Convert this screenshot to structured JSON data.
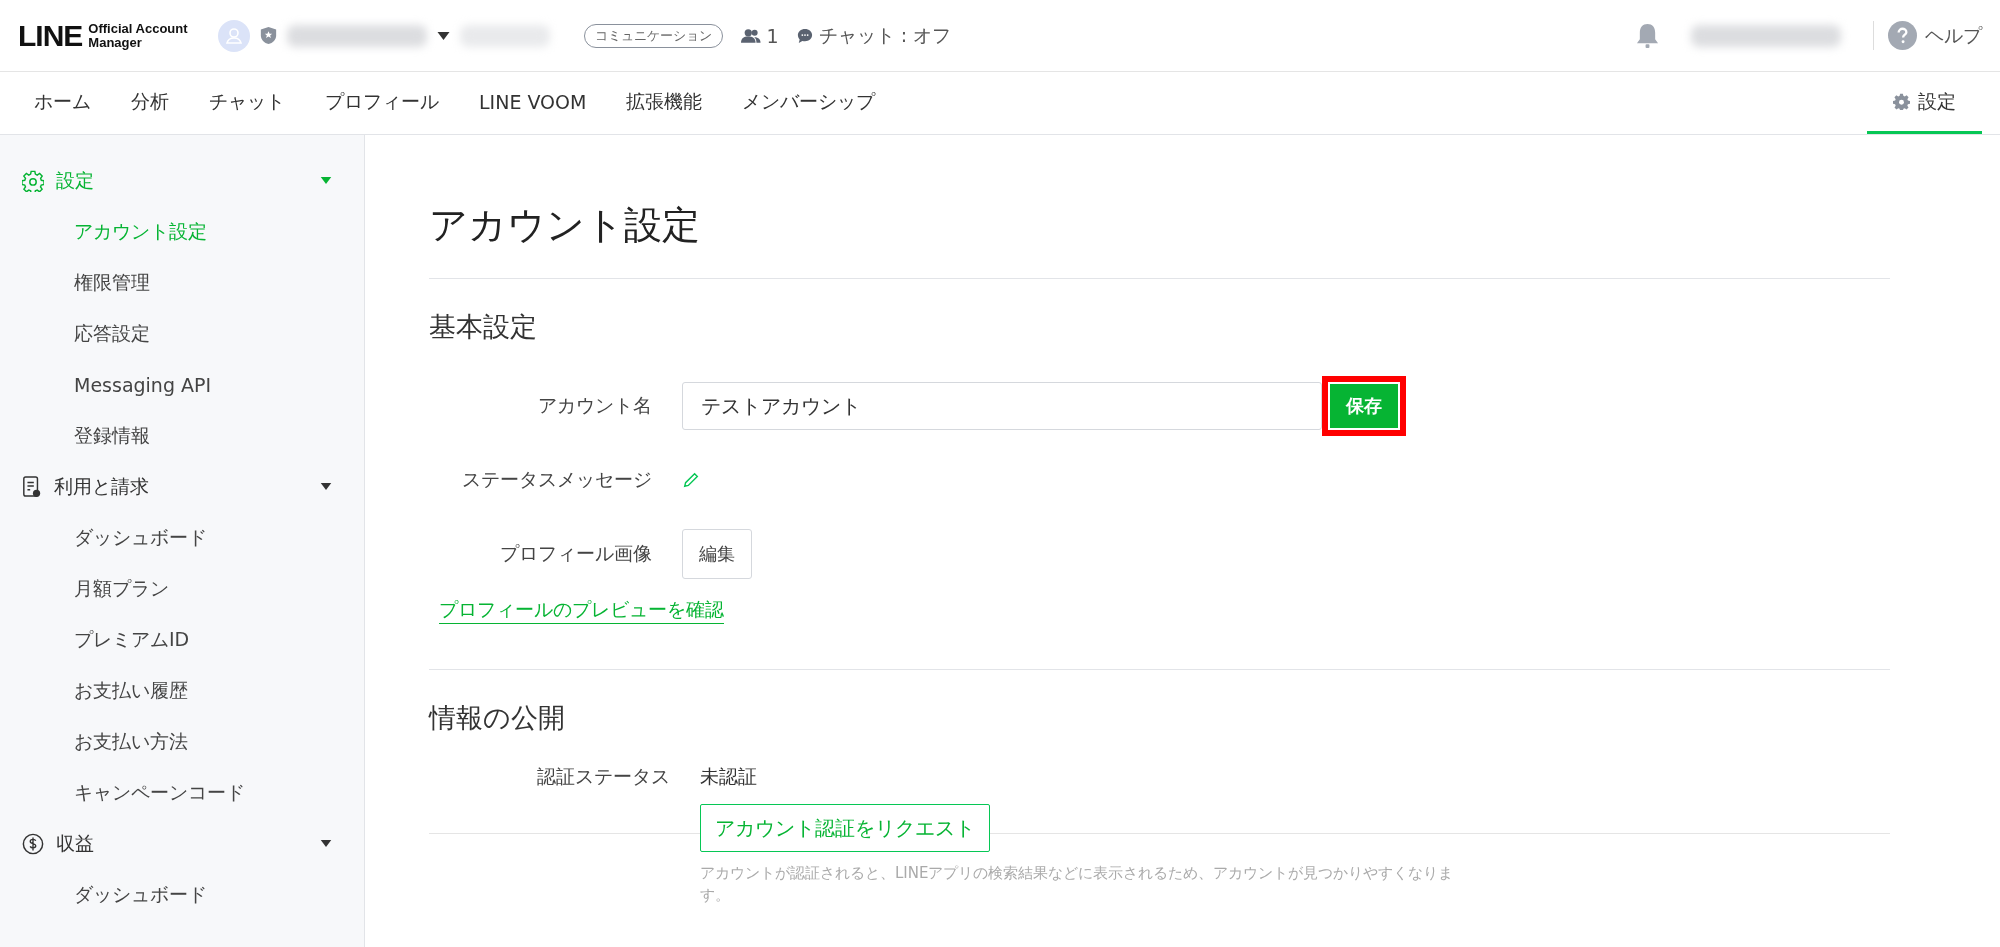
{
  "header": {
    "logo": {
      "wordmark": "LINE",
      "subtitle_line1": "Official Account",
      "subtitle_line2": "Manager"
    },
    "plan_badge": "コミュニケーション",
    "friends_count": "1",
    "chat_status": "チャット : オフ",
    "help": "ヘルプ"
  },
  "nav": {
    "tabs": [
      {
        "label": "ホーム",
        "selected": false
      },
      {
        "label": "分析",
        "selected": false
      },
      {
        "label": "チャット",
        "selected": false
      },
      {
        "label": "プロフィール",
        "selected": false
      },
      {
        "label": "LINE VOOM",
        "selected": false
      },
      {
        "label": "拡張機能",
        "selected": false
      },
      {
        "label": "メンバーシップ",
        "selected": false
      }
    ],
    "settings_tab": {
      "label": "設定",
      "selected": true
    }
  },
  "sidebar": {
    "groups": [
      {
        "kind": "settings",
        "label": "設定",
        "expanded": true,
        "selected": true,
        "items": [
          {
            "label": "アカウント設定",
            "selected": true
          },
          {
            "label": "権限管理",
            "selected": false
          },
          {
            "label": "応答設定",
            "selected": false
          },
          {
            "label": "Messaging API",
            "selected": false
          },
          {
            "label": "登録情報",
            "selected": false
          }
        ]
      },
      {
        "kind": "billing",
        "label": "利用と請求",
        "expanded": true,
        "selected": false,
        "items": [
          {
            "label": "ダッシュボード",
            "selected": false
          },
          {
            "label": "月額プラン",
            "selected": false
          },
          {
            "label": "プレミアムID",
            "selected": false
          },
          {
            "label": "お支払い履歴",
            "selected": false
          },
          {
            "label": "お支払い方法",
            "selected": false
          },
          {
            "label": "キャンペーンコード",
            "selected": false
          }
        ]
      },
      {
        "kind": "revenue",
        "label": "収益",
        "expanded": true,
        "selected": false,
        "items": [
          {
            "label": "ダッシュボード",
            "selected": false
          }
        ]
      }
    ]
  },
  "page": {
    "title": "アカウント設定",
    "basic": {
      "heading": "基本設定",
      "account_name_label": "アカウント名",
      "account_name_value": "テストアカウント",
      "save_button": "保存",
      "save_highlighted": true,
      "status_message_label": "ステータスメッセージ",
      "profile_image_label": "プロフィール画像",
      "edit_button": "編集",
      "preview_link": "プロフィールのプレビューを確認"
    },
    "publish": {
      "heading": "情報の公開",
      "verification_label": "認証ステータス",
      "verification_value": "未認証",
      "request_button": "アカウント認証をリクエスト",
      "hint": "アカウントが認証されると、LINEアプリの検索結果などに表示されるため、アカウントが見つかりやすくなります。"
    }
  }
}
